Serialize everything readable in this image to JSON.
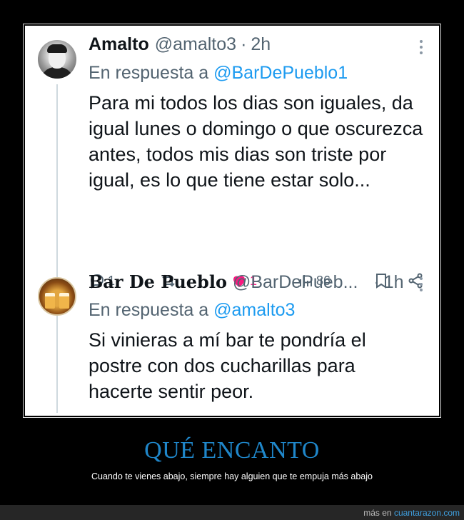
{
  "tweets": [
    {
      "name": "Amalto",
      "handle": "@amalto3",
      "separator": "·",
      "time": "2h",
      "reply_prefix": "En respuesta a",
      "reply_to": "@BarDePueblo1",
      "text": "Para mi todos los dias son iguales, da igual lunes o domingo o que oscurezca antes, todos mis dias son triste por igual, es lo que tiene estar solo...",
      "actions": {
        "replies": "1",
        "retweets": "",
        "likes": "1",
        "views": "86"
      },
      "liked": true
    },
    {
      "name": "Bar De Pueblo",
      "handle": "@BarDePueb...",
      "separator": "·",
      "time": "1h",
      "reply_prefix": "En respuesta a",
      "reply_to": "@amalto3",
      "text": "Si vinieras a mí bar te pondría el postre con dos cucharillas para hacerte sentir peor."
    }
  ],
  "caption": {
    "title": "QUÉ ENCANTO",
    "subtitle": "Cuando te vienes abajo, siempre hay alguien que te empuja más abajo"
  },
  "footer": {
    "prefix": "más en",
    "site": "cuantarazon.com"
  },
  "colors": {
    "accent": "#1d9bf0",
    "like": "#f91880",
    "caption": "#1f86c9",
    "muted": "#536471"
  },
  "icons": [
    "reply-icon",
    "retweet-icon",
    "heart-icon",
    "views-icon",
    "bookmark-icon",
    "share-icon",
    "more-icon"
  ]
}
